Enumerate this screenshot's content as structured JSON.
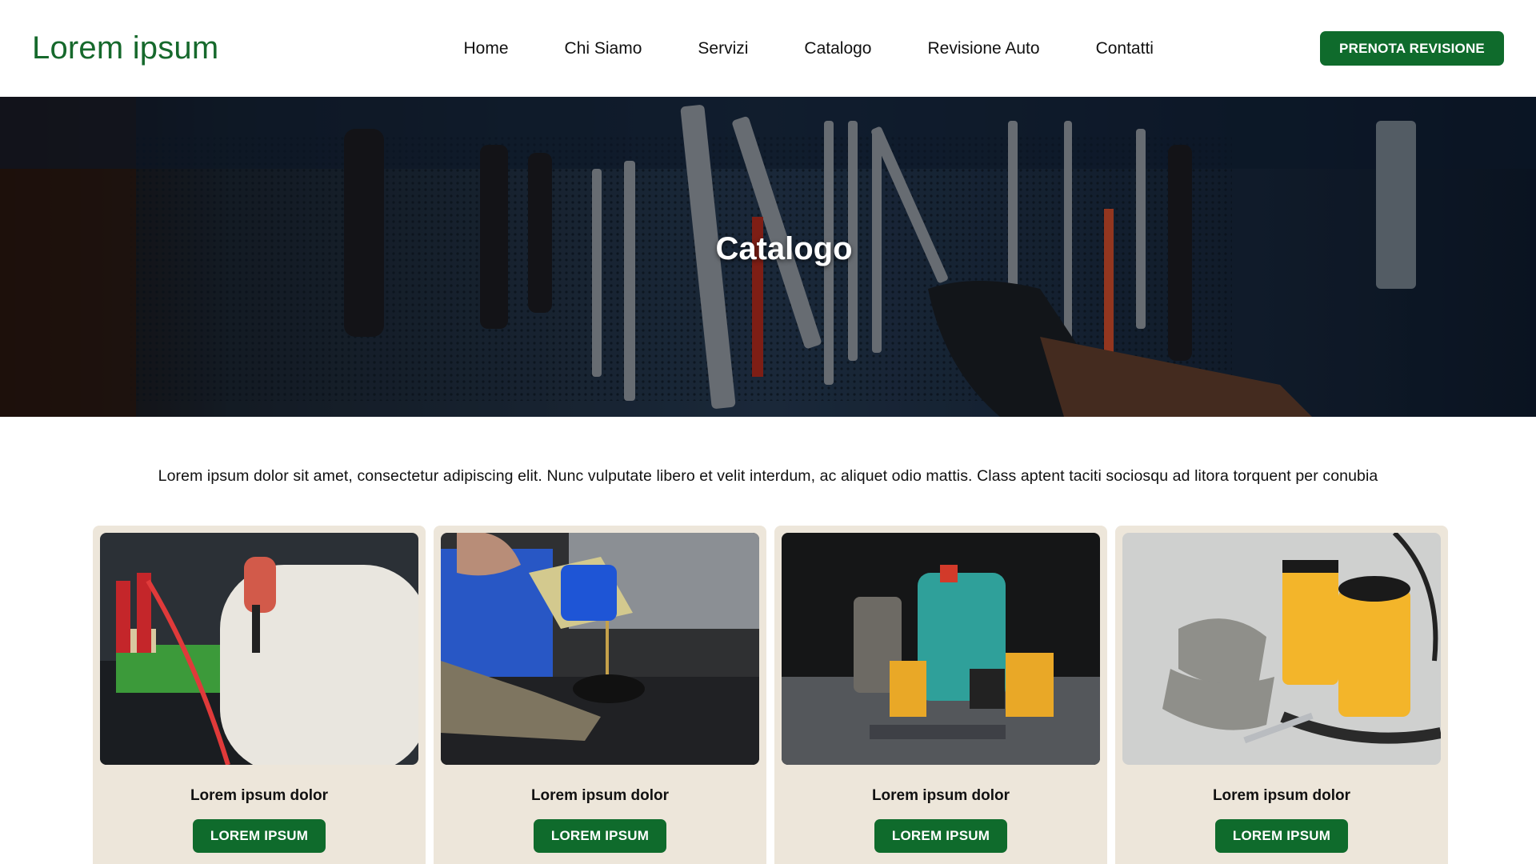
{
  "brand": {
    "logo": "Lorem ipsum",
    "color": "#16692c"
  },
  "nav": {
    "items": [
      "Home",
      "Chi Siamo",
      "Servizi",
      "Catalogo",
      "Revisione Auto",
      "Contatti"
    ],
    "cta_label": "PRENOTA REVISIONE"
  },
  "hero": {
    "title": "Catalogo",
    "image": "workshop-tools-wall"
  },
  "intro": {
    "text": "Lorem ipsum dolor sit amet, consectetur adipiscing elit. Nunc vulputate libero et velit interdum, ac aliquet odio mattis. Class aptent taciti sociosqu ad litora torquent per conubia"
  },
  "cards": [
    {
      "image": "battery-jump-start",
      "title": "Lorem ipsum dolor",
      "button": "LOREM IPSUM"
    },
    {
      "image": "oil-change",
      "title": "Lorem ipsum dolor",
      "button": "LOREM IPSUM"
    },
    {
      "image": "car-parts-oil-filters",
      "title": "Lorem ipsum dolor",
      "button": "LOREM IPSUM"
    },
    {
      "image": "brake-pads-filters",
      "title": "Lorem ipsum dolor",
      "button": "LOREM IPSUM"
    }
  ],
  "colors": {
    "accent": "#0f6b2c",
    "card_bg": "#ede6da"
  }
}
